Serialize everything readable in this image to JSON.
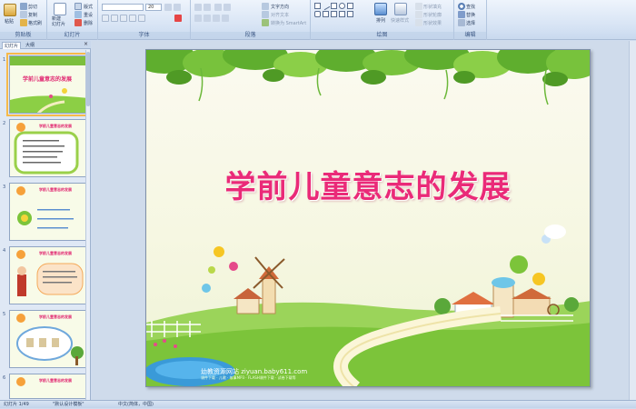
{
  "ribbon": {
    "clipboard": {
      "label": "剪贴板",
      "paste": "粘贴",
      "cut": "剪切",
      "copy": "复制",
      "format_painter": "格式刷"
    },
    "slides": {
      "label": "幻灯片",
      "new_slide": "新建\n幻灯片",
      "layout": "版式",
      "reset": "重设",
      "delete": "删除"
    },
    "font": {
      "label": "字体",
      "font_name": "",
      "font_size": "20"
    },
    "paragraph": {
      "label": "段落",
      "text_direction": "文字方向",
      "align_text": "对齐文本",
      "smartart": "转换为 SmartArt"
    },
    "drawing": {
      "label": "绘图",
      "arrange": "排列",
      "quick_styles": "快速样式",
      "shape_fill": "形状填充",
      "shape_outline": "形状轮廓",
      "shape_effects": "形状效果"
    },
    "editing": {
      "label": "编辑",
      "find": "查找",
      "replace": "替换",
      "select": "选择"
    }
  },
  "panel": {
    "tab_slides": "幻灯片",
    "tab_outline": "大纲",
    "close": "×",
    "thumbnails": [
      {
        "num": "1",
        "title": "学前儿童意志的发展",
        "selected": true
      },
      {
        "num": "2",
        "title": "学前儿童意志的发展",
        "selected": false
      },
      {
        "num": "3",
        "title": "学前儿童意志的发展",
        "selected": false
      },
      {
        "num": "4",
        "title": "学前儿童意志的发展",
        "selected": false
      },
      {
        "num": "5",
        "title": "学前儿童意志的发展",
        "selected": false
      },
      {
        "num": "6",
        "title": "学前儿童意志的发展",
        "selected": false
      }
    ]
  },
  "slide": {
    "title": "学前儿童意志的发展",
    "brand": "幼教资源网站  ziyuan.baby611.com",
    "brand_sub": "课件下载 · 儿歌 · 故事MP3 · FLASH课件下载 · 试卷下载等"
  },
  "status": {
    "slide_counter": "幻灯片 1/49",
    "theme": "\"默认设计模板\"",
    "language": "中文(简体，中国)"
  },
  "colors": {
    "title_pink": "#ea2a78",
    "grass_green": "#7cc43a",
    "ribbon_blue": "#d6e3f4"
  }
}
